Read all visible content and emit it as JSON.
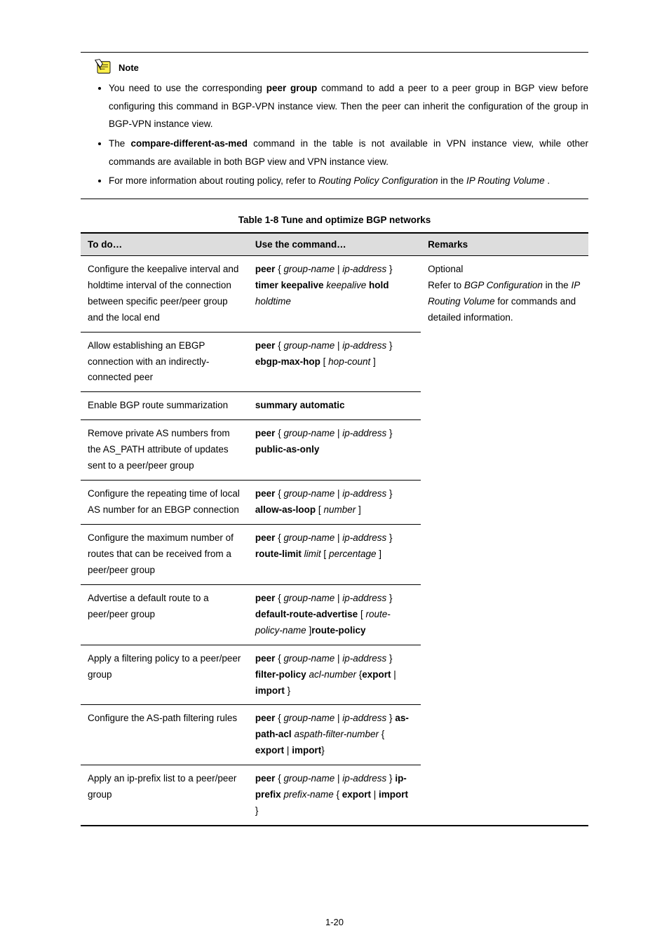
{
  "note": {
    "label": "Note",
    "bullets": [
      {
        "main": "You need to use the corresponding",
        "cmd1_b": "peer group",
        "mid": " command to add a peer to a peer group in BGP view before configuring this command in BGP-VPN instance view. Then the peer can inherit the configuration of the group in BGP-VPN instance view.",
        "cmd2": ""
      },
      {
        "main": "The ",
        "cmd1_b": "compare-different-as-med",
        "mid": " command in the table is not available in VPN instance view, while other commands are available in both BGP view and VPN instance view.",
        "cmd2": ""
      },
      {
        "main": "For more information about routing policy, refer to ",
        "cmd1_b": "",
        "mid": "",
        "italic": "Routing Policy Configuration",
        "tail": " in the ",
        "italic2": "IP Routing Volume",
        "tail2": "."
      }
    ]
  },
  "table_caption": "Table 1-8 Tune and optimize BGP networks",
  "table": {
    "headers": [
      "To do…",
      "Use the command…",
      "Remarks"
    ],
    "rows": [
      {
        "todo_lines": [
          "Configure the keepalive interval and holdtime interval of the connection between specific peer/peer group and the local end"
        ],
        "cmd_lines": [
          {
            "b": "peer",
            "after_b": " { ",
            "i": "group-name",
            "after_i": " | ",
            "i2": "ip-address",
            "after_i2": " } ",
            "b2": "timer keepalive",
            "after_b2": " ",
            "i3": "keepalive",
            "after_i3": " ",
            "b3": "hold",
            "after_b3": " ",
            "i4": "holdtime",
            "after_i4": ""
          }
        ]
      },
      {
        "todo_lines": [
          "Allow establishing an EBGP connection with an indirectly-connected peer"
        ],
        "cmd_lines": [
          {
            "b": "peer",
            "after_b": " { ",
            "i": "group-name",
            "after_i": " | ",
            "i2": "ip-address",
            "after_i2": " } ",
            "b2": "ebgp-max-hop",
            "after_b2": " [ ",
            "i3": "hop-count",
            "after_i3": " ]",
            "b3": "",
            "after_b3": "",
            "i4": "",
            "after_i4": ""
          }
        ]
      },
      {
        "todo_lines": [
          "Enable BGP route summarization"
        ],
        "cmd_lines": [
          {
            "b": "summary automatic",
            "after_b": "",
            "i": "",
            "after_i": "",
            "i2": "",
            "after_i2": "",
            "b2": "",
            "after_b2": "",
            "i3": "",
            "after_i3": "",
            "b3": "",
            "after_b3": "",
            "i4": "",
            "after_i4": ""
          }
        ]
      },
      {
        "todo_lines": [
          "Remove private AS numbers from the AS_PATH attribute of updates sent to a peer/peer group"
        ],
        "cmd_lines": [
          {
            "b": "peer",
            "after_b": " { ",
            "i": "group-name",
            "after_i": " | ",
            "i2": "ip-address",
            "after_i2": " } ",
            "b2": "public-as-only",
            "after_b2": "",
            "i3": "",
            "after_i3": "",
            "b3": "",
            "after_b3": "",
            "i4": "",
            "after_i4": ""
          }
        ]
      },
      {
        "todo_lines": [
          "Configure the repeating time of local AS number for an EBGP connection"
        ],
        "cmd_lines": [
          {
            "b": "peer",
            "after_b": " { ",
            "i": "group-name",
            "after_i": " | ",
            "i2": "ip-address",
            "after_i2": " } ",
            "b2": "allow-as-loop",
            "after_b2": " [ ",
            "i3": "number",
            "after_i3": " ]",
            "b3": "",
            "after_b3": "",
            "i4": "",
            "after_i4": ""
          }
        ]
      },
      {
        "todo_lines": [
          "Configure the maximum number of routes that can be received from a peer/peer group"
        ],
        "cmd_lines": [
          {
            "b": "peer",
            "after_b": " { ",
            "i": "group-name",
            "after_i": " | ",
            "i2": "ip-address",
            "after_i2": " } ",
            "b2": "route-limit",
            "after_b2": " ",
            "i3": "limit",
            "after_i3": " [ ",
            "i4": "percentage",
            "after_i4": " ]",
            "b3": "",
            "after_b3": ""
          }
        ]
      },
      {
        "todo_lines": [
          "Advertise a default route to a peer/peer group"
        ],
        "cmd_lines": [
          {
            "b": "peer",
            "after_b": " { ",
            "i": "group-name",
            "after_i": " | ",
            "i2": "ip-address",
            "after_i2": " } ",
            "b2": "default-route-advertise",
            "after_b2": " [ ",
            "b3": "route-policy",
            "after_b3": " ",
            "i3": "route-policy-name",
            "after_i3": " ]",
            "i4": "",
            "after_i4": ""
          }
        ]
      },
      {
        "todo_lines": [
          "Apply a filtering policy to a peer/peer group"
        ],
        "cmd_lines": [
          {
            "b": "peer",
            "after_b": " { ",
            "i": "group-name",
            "after_i": " | ",
            "i2": "ip-address",
            "after_i2": " } ",
            "b2": "filter-policy",
            "after_b2": " ",
            "i3": "acl-number",
            "after_i3": " {",
            "b3": "export",
            "after_b3": " | ",
            "b4": "import",
            "after_b4": " }",
            "i4": "",
            "after_i4": ""
          }
        ]
      },
      {
        "todo_lines": [
          "Configure the AS-path filtering rules"
        ],
        "cmd_lines": [
          {
            "b": "peer",
            "after_b": " { ",
            "i": "group-name",
            "after_i": " | ",
            "i2": "ip-address",
            "after_i2": " } ",
            "b2": "as-path-acl",
            "after_b2": " ",
            "i3": "aspath-filter-number",
            "after_i3": " { ",
            "b3": "export",
            "after_b3": " | ",
            "b4": "import",
            "after_b4": "}",
            "i4": "",
            "after_i4": ""
          }
        ]
      },
      {
        "todo_lines": [
          "Apply an ip-prefix list to a peer/peer group"
        ],
        "cmd_lines": [
          {
            "b": "peer",
            "after_b": " { ",
            "i": "group-name",
            "after_i": " | ",
            "i2": "ip-address",
            "after_i2": " } ",
            "b2": "ip-prefix",
            "after_b2": " ",
            "i3": "prefix-name",
            "after_i3": " { ",
            "b3": "export",
            "after_b3": " | ",
            "b4": "import",
            "after_b4": " }",
            "i4": "",
            "after_i4": ""
          }
        ]
      }
    ],
    "remarks_line1": "Optional",
    "remarks_line2": "Refer to ",
    "remarks_italic": "BGP Configuration",
    "remarks_line3": " in the ",
    "remarks_italic2": "IP Routing Volume",
    "remarks_line4": " for commands and detailed information."
  },
  "page_number": "1-20"
}
